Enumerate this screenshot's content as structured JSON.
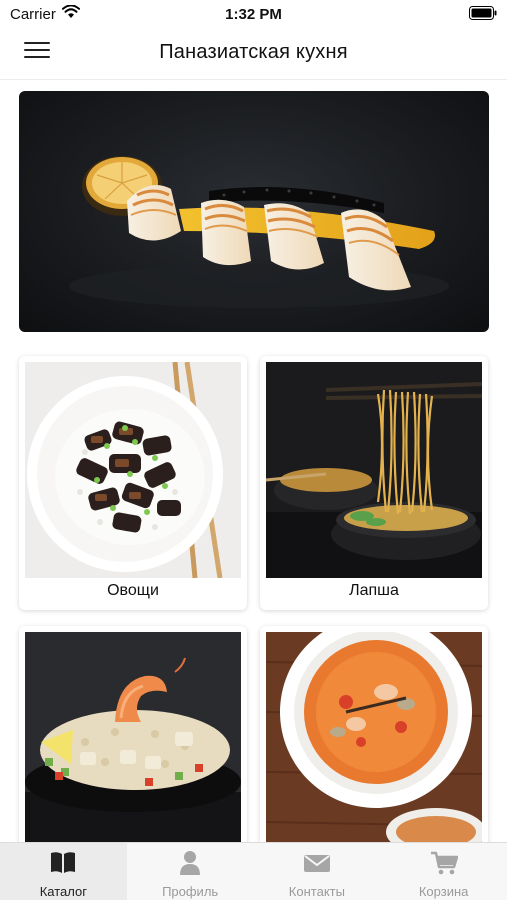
{
  "status_bar": {
    "carrier": "Carrier",
    "time": "1:32 PM"
  },
  "header": {
    "title": "Паназиатская кухня",
    "menu_icon": "hamburger-menu-icon"
  },
  "banner": {
    "image": "grilled-fish-sushi-banner"
  },
  "categories": [
    {
      "label": "Овощи",
      "image": "eggplant-rice-bowl"
    },
    {
      "label": "Лапша",
      "image": "noodles-bowl"
    },
    {
      "label": "",
      "image": "shrimp-rice-plate"
    },
    {
      "label": "",
      "image": "tom-yum-soup"
    }
  ],
  "tabbar": {
    "items": [
      {
        "label": "Каталог",
        "icon": "book-icon",
        "active": true
      },
      {
        "label": "Профиль",
        "icon": "person-icon",
        "active": false
      },
      {
        "label": "Контакты",
        "icon": "envelope-icon",
        "active": false
      },
      {
        "label": "Корзина",
        "icon": "cart-icon",
        "active": false
      }
    ],
    "active_color": "#222222",
    "inactive_color": "#9a9a9a"
  }
}
